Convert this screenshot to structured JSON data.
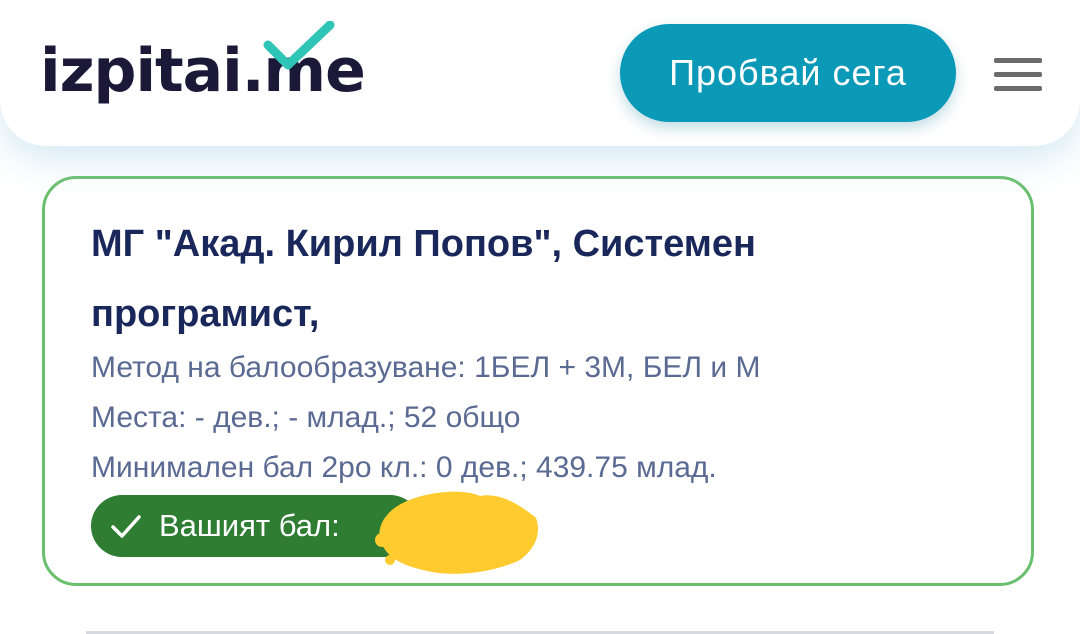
{
  "header": {
    "logo": {
      "part1": "izpitai.",
      "part2": "me"
    },
    "cta_label": "Пробвай сега",
    "menu_icon": "hamburger-menu-icon"
  },
  "card": {
    "title": "МГ \"Акад. Кирил Попов\", Системен програмист,",
    "method": "Метод на балообразуване: 1БЕЛ + 3М, БЕЛ и М",
    "places": "Места: - дев.; - млад.; 52 общо",
    "min_score": "Минимален бал 2ро кл.: 0 дев.; 439.75 млад.",
    "badge": {
      "icon": "check-icon",
      "label": "Вашият бал:"
    }
  },
  "colors": {
    "brand_dark": "#1c1838",
    "brand_accent": "#2ec4b6",
    "cta": "#0b99b8",
    "card_border": "#6abf6e",
    "badge": "#2e7d32",
    "title": "#19275a",
    "meta_text": "#5a6a92",
    "redaction": "#ffcb2f"
  }
}
